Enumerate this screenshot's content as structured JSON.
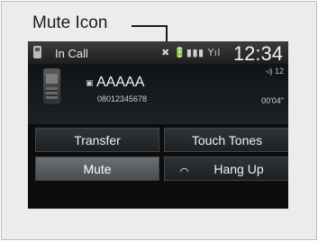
{
  "callout": {
    "label": "Mute Icon"
  },
  "status_bar": {
    "title": "In Call",
    "icons": "✖ 🔋▮▮▮ Yıl",
    "clock": "12:34"
  },
  "call": {
    "contact_type_icon": "▣",
    "name": "AAAAA",
    "number": "08012345678",
    "volume": "◃) 12",
    "duration": "00'04\""
  },
  "buttons": {
    "transfer": "Transfer",
    "touch_tones": "Touch Tones",
    "mute": "Mute",
    "hang_up": "Hang Up"
  }
}
